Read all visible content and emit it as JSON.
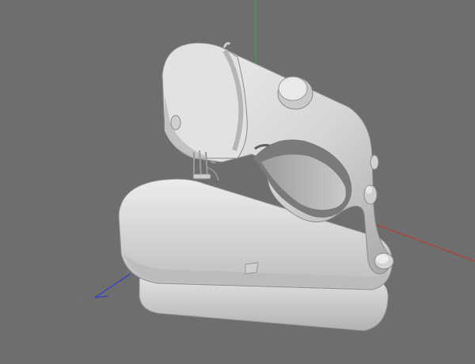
{
  "viewport": {
    "background_color": "#6e6e6e",
    "grid_color": "#7a7a7a",
    "model_color": "#d9d9d9",
    "model_shadow_color": "#9a9a9a",
    "axes": {
      "x_axis_color": "#c0392b",
      "y_axis_color": "#2fa84f",
      "z_axis_color": "#2f3fc8"
    },
    "model_icon": "sewing-machine-3d-model"
  }
}
